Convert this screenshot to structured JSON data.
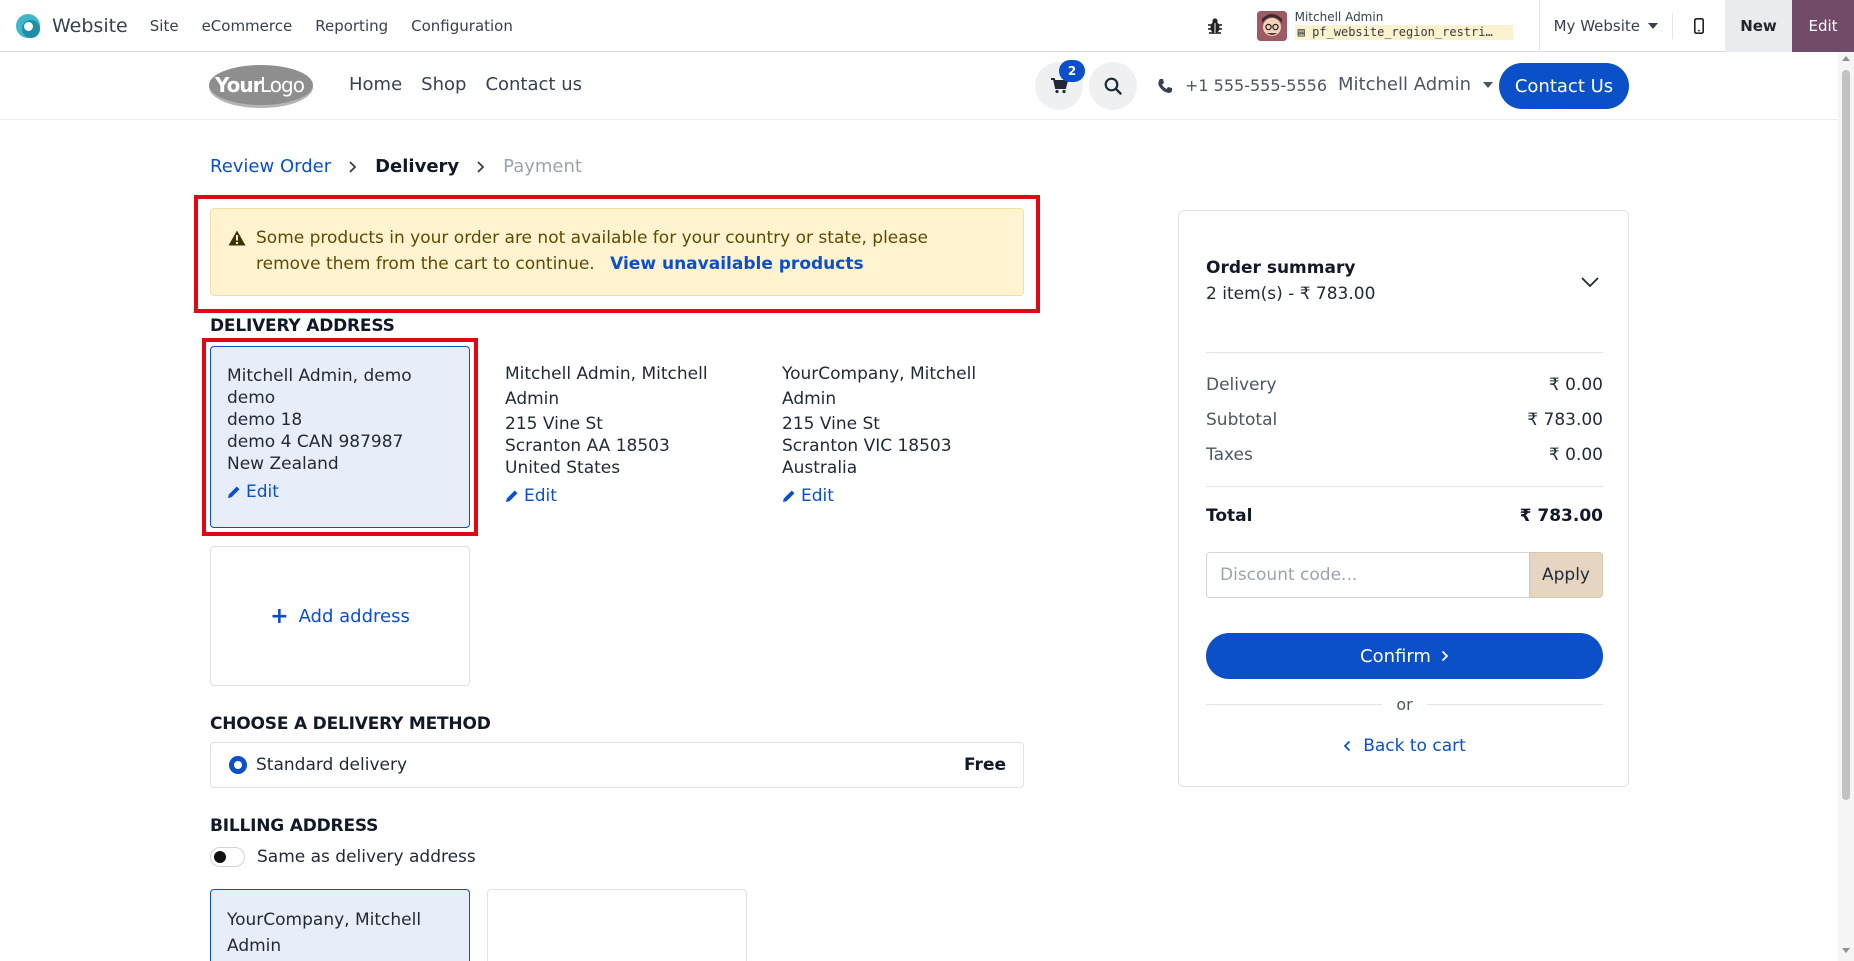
{
  "admin_bar": {
    "app_name": "Website",
    "menu": [
      "Site",
      "eCommerce",
      "Reporting",
      "Configuration"
    ],
    "user_name": "Mitchell Admin",
    "database": "pf_website_region_restri…",
    "website_selector": "My Website",
    "new_label": "New",
    "edit_label": "Edit",
    "accent_color": "#714b67"
  },
  "site_header": {
    "logo_text": "YourLogo",
    "nav": [
      "Home",
      "Shop",
      "Contact us"
    ],
    "cart_count": "2",
    "phone": "+1 555-555-5556",
    "user": "Mitchell Admin",
    "contact_button": "Contact Us",
    "brand_color": "#0b50c8"
  },
  "breadcrumb": {
    "steps": [
      "Review Order",
      "Delivery",
      "Payment"
    ]
  },
  "alert": {
    "message": "Some products in your order are not available for your country or state, please remove them from the cart to continue.",
    "link": "View unavailable products"
  },
  "delivery_address": {
    "title": "DELIVERY ADDRESS",
    "cards": [
      {
        "lines": [
          "Mitchell Admin, demo",
          "demo",
          "demo 18",
          "demo 4 CAN 987987",
          "New Zealand"
        ],
        "edit": "Edit",
        "selected": true
      },
      {
        "lines": [
          "Mitchell Admin, Mitchell",
          "Admin",
          "215 Vine St",
          "Scranton AA 18503",
          "United States"
        ],
        "edit": "Edit",
        "selected": false
      },
      {
        "lines": [
          "YourCompany, Mitchell",
          "Admin",
          "215 Vine St",
          "Scranton VIC 18503",
          "Australia"
        ],
        "edit": "Edit",
        "selected": false
      }
    ],
    "add_label": "Add address"
  },
  "delivery_method": {
    "title": "CHOOSE A DELIVERY METHOD",
    "option": "Standard delivery",
    "price": "Free"
  },
  "billing": {
    "title": "BILLING ADDRESS",
    "toggle_label": "Same as delivery address",
    "card_lines": [
      "YourCompany, Mitchell",
      "Admin"
    ]
  },
  "summary": {
    "title": "Order summary",
    "items_text": "2 item(s) -  ₹ 783.00",
    "rows": [
      {
        "label": "Delivery",
        "value": "₹ 0.00"
      },
      {
        "label": "Subtotal",
        "value": "₹ 783.00"
      },
      {
        "label": "Taxes",
        "value": "₹ 0.00"
      }
    ],
    "total_label": "Total",
    "total_value": "₹ 783.00",
    "discount_placeholder": "Discount code...",
    "apply": "Apply",
    "confirm": "Confirm",
    "or": "or",
    "back": "Back to cart"
  }
}
